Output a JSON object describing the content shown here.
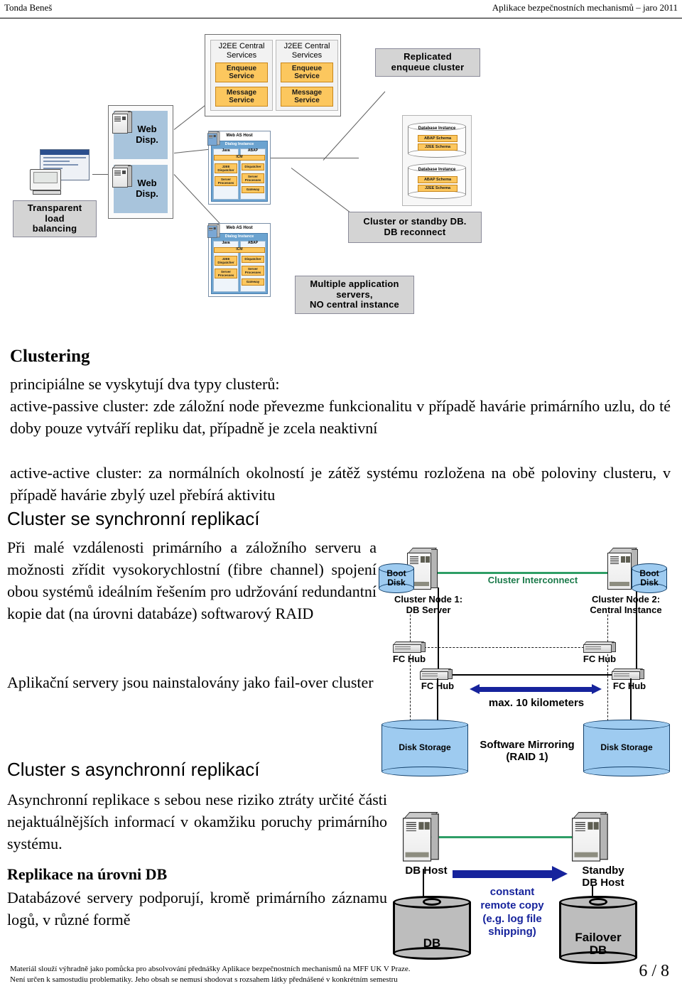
{
  "header": {
    "author": "Tonda Beneš",
    "course": "Aplikace bezpečnostních mechanismů – jaro 2011"
  },
  "top_diagram": {
    "j2ee_title": "J2EE Central\nServices",
    "enqueue_service": "Enqueue\nService",
    "message_service": "Message\nService",
    "replicated_enqueue": "Replicated\nenqueue cluster",
    "web_disp": "Web\nDisp.",
    "transparent_load_balancing": "Transparent\nload\nbalancing",
    "web_as_host": "Web AS Host",
    "dialog_instance": "Dialog Instance",
    "java_col": "Java",
    "abap_col": "ABAP",
    "icm": "ICM",
    "j2ee_dispatcher": "J2EE\nDispatcher",
    "server_processes": "Server\nProcesses",
    "dispatcher": "Dispatcher",
    "gateway": "Gateway",
    "database_instance": "Database Instance",
    "abap_schema": "ABAP Schema",
    "j2ee_schema": "J2EE Schema",
    "cluster_standby_db": "Cluster or standby DB.\nDB reconnect",
    "multiple_app_servers": "Multiple application\nservers,\nNO central instance"
  },
  "sections": {
    "clustering_title": "Clustering",
    "clustering_lines": [
      "principiálne se vyskytují dva typy clusterů:",
      "active-passive cluster: zde záložní node převezme funkcionalitu v případě havárie primárního uzlu, do té doby pouze vytváří repliku dat, případně je zcela neaktivní",
      "active-active cluster: za normálních okolností je zátěž systému rozložena na obě poloviny clusteru, v případě havárie zbylý uzel přebírá aktivitu"
    ],
    "sync_title": "Cluster se synchronní replikací",
    "sync_body": "Při malé vzdálenosti primárního a záložního serveru a možnosti zřídit vysokorychlostní (fibre channel) spojení obou systémů ideálním řešením pro udržování redundantní kopie dat (na úrovni databáze) softwarový RAID",
    "sync_body2": "Aplikační servery jsou nainstalovány jako fail-over cluster",
    "async_title": "Cluster s asynchronní replikací",
    "async_body": "Asynchronní replikace s sebou nese riziko ztráty určité části nejaktuálnějších informací v okamžiku poruchy primárního systému.",
    "db_repl_title": "Replikace na úrovni DB",
    "db_repl_body": "Databázové servery podporují, kromě primárního záznamu logů, v různé formě"
  },
  "sync_diagram": {
    "boot_disk": "Boot\nDisk",
    "cluster_interconnect": "Cluster Interconnect",
    "node1": "Cluster Node 1:\nDB Server",
    "node2": "Cluster Node 2:\nCentral Instance",
    "fc_hub": "FC Hub",
    "max_distance": "max. 10 kilometers",
    "disk_storage": "Disk Storage",
    "software_mirroring": "Software Mirroring\n(RAID 1)"
  },
  "async_diagram": {
    "db_host": "DB Host",
    "standby_db_host": "Standby\nDB Host",
    "db": "DB",
    "failover_db": "Failover\nDB",
    "remote_copy": "constant\nremote copy\n(e.g. log file\nshipping)"
  },
  "footer": {
    "line1": "Materiál slouží výhradně jako pomůcka pro absolvování přednášky Aplikace bezpečnostních mechanismů na MFF UK V Praze.",
    "line2": "Není určen k samostudiu problematiky. Jeho obsah se nemusí shodovat s rozsahem látky přednášené v konkrétním semestru",
    "page": "6 / 8"
  },
  "colors": {
    "orange": "#fcc75e",
    "blue_light": "#a8c4dc",
    "cyl_blue": "#9ecbf0",
    "green_line": "#2e9e66",
    "navy": "#16239c",
    "gray_callout": "#d4d4d4"
  }
}
